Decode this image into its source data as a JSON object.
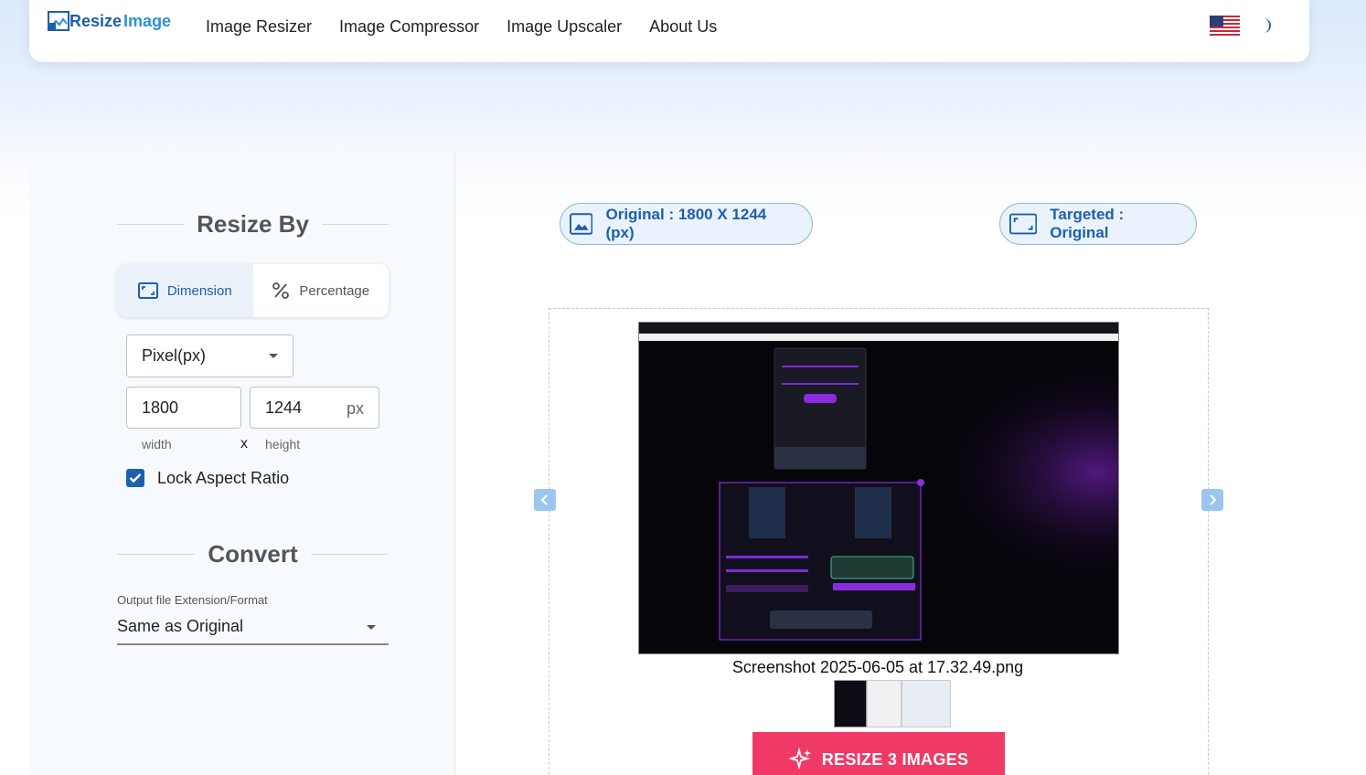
{
  "header": {
    "logo_part1": "Resize",
    "logo_part2": "Image",
    "nav": [
      "Image Resizer",
      "Image Compressor",
      "Image Upscaler",
      "About Us"
    ]
  },
  "resize_by": {
    "heading": "Resize By",
    "tab_dimension": "Dimension",
    "tab_percentage": "Percentage",
    "unit_select": "Pixel(px)",
    "width_value": "1800",
    "height_value": "1244",
    "unit_suffix": "px",
    "width_label": "width",
    "separator": "x",
    "height_label": "height",
    "lock_aspect_label": "Lock Aspect Ratio",
    "lock_aspect_checked": true
  },
  "convert": {
    "heading": "Convert",
    "format_label": "Output file Extension/Format",
    "format_value": "Same as Original"
  },
  "preview": {
    "original_label": "Original : 1800 X 1244 (px)",
    "targeted_label": "Targeted : Original",
    "filename": "Screenshot 2025-06-05 at 17.32.49.png",
    "resize_button": "RESIZE 3 IMAGES"
  },
  "colors": {
    "brand_blue": "#1e5fae",
    "accent_pink": "#ef3a68",
    "pill_bg": "#eaf3fd"
  }
}
